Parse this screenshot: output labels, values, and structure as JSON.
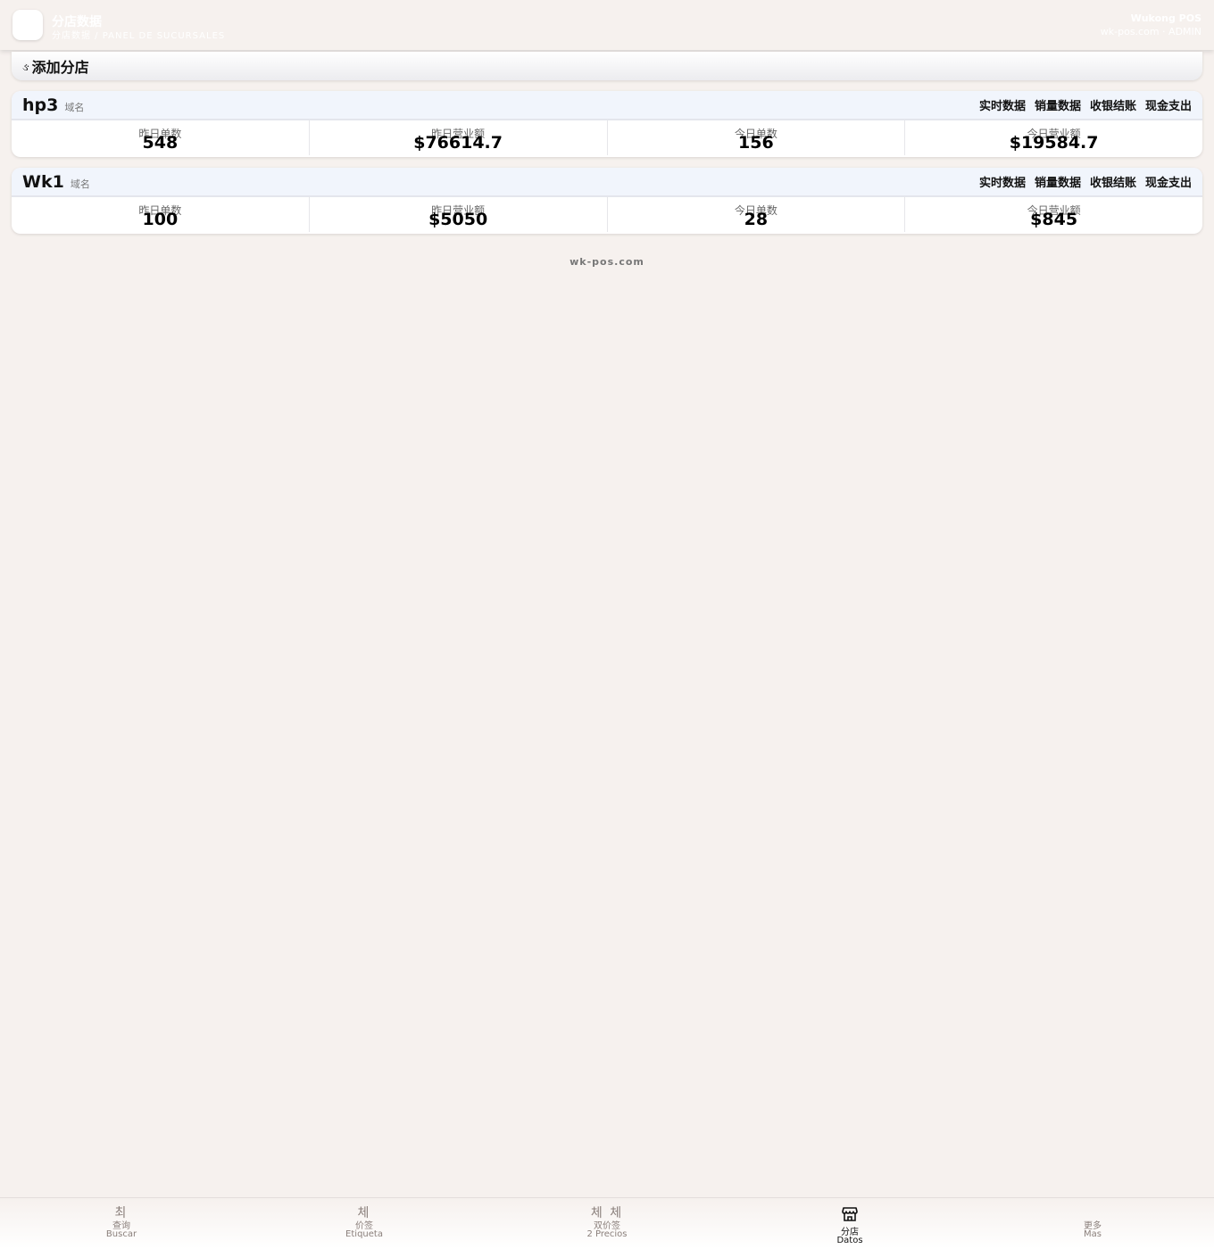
{
  "header": {
    "title": "分店数据",
    "subtitle": "分店数据 / PANEL DE SUCURSALES",
    "brand": "Wukong POS",
    "domain": "wk-pos.com · ADMIN"
  },
  "add_branch": {
    "icon": "ઙ",
    "label": "添加分店"
  },
  "stat_labels": {
    "yesterday_orders": "昨日单数",
    "yesterday_revenue": "昨日营业额",
    "today_orders": "今日单数",
    "today_revenue": "今日营业额"
  },
  "links": {
    "realtime": "实时数据",
    "sales": "销量数据",
    "checkout": "收银结账",
    "cash_out": "现金支出"
  },
  "stores": [
    {
      "name": "hp3",
      "domain_label": "域名",
      "yesterday_orders": "548",
      "yesterday_revenue": "$76614.7",
      "today_orders": "156",
      "today_revenue": "$19584.7"
    },
    {
      "name": "Wk1",
      "domain_label": "域名",
      "yesterday_orders": "100",
      "yesterday_revenue": "$5050",
      "today_orders": "28",
      "today_revenue": "$845"
    }
  ],
  "footer": "wk-pos.com",
  "nav": [
    {
      "icon": "최",
      "cn": "查询",
      "es": "Buscar",
      "active": false
    },
    {
      "icon": "체",
      "cn": "价签",
      "es": "Etiqueta",
      "active": false
    },
    {
      "icon": "체 체",
      "cn": "双价签",
      "es": "2 Precios",
      "active": false
    },
    {
      "icon": "store-icon",
      "cn": "分店",
      "es": "Datos",
      "active": true
    },
    {
      "icon": "",
      "cn": "更多",
      "es": "Mas",
      "active": false
    }
  ],
  "colors": {
    "background": "#f6f1ee",
    "card_header": "#f1f5fc",
    "nav_inactive": "#8a7f7b"
  }
}
